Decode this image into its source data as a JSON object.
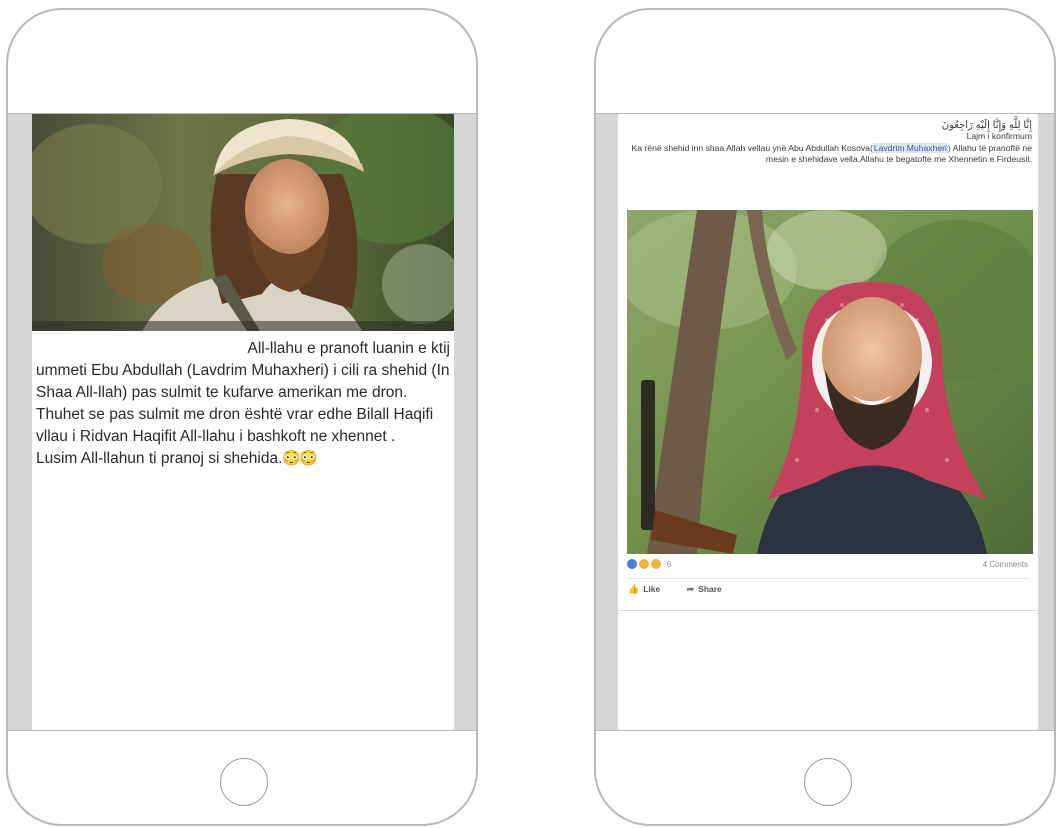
{
  "left_post": {
    "text_lines": [
      "All-llahu e pranoft luanin e ktij",
      "ummeti Ebu Abdullah (Lavdrim Muhaxheri)  i cili ra shehid (In Shaa All-llah) pas sulmit te kufarve amerikan me dron.",
      "Thuhet se pas sulmit me dron është vrar edhe Bilall Haqifi vllau i Ridvan Haqifit All-llahu i bashkoft ne xhennet .",
      "Lusim All-llahun ti pranoj si shehida."
    ],
    "emoji": "😳😳"
  },
  "right_post": {
    "header_arabic": "إِنَّا لِلَّهِ وَإِنَّا إِلَيْهِ رَاجِعُونَ",
    "header_line2": "Lajm i konfirmum",
    "body_before_tag": "Ka rënë shehid inn shaa Allah vellau ynë Abu Abdullah Kosova(",
    "tag": "Lavdrim Muhaxheri",
    "body_after_tag": ") Allahu të pranoftë ne mesin e shehidave vella.Allahu te begatofte me Xhennetin e Firdeusit.",
    "reaction_count": "6",
    "comments": "4 Comments",
    "like_label": "Like",
    "share_label": "Share"
  },
  "colors": {
    "phone_border": "#b8b8b8",
    "screen_gutter": "#d6d6d6",
    "facebook_link": "#3b5998",
    "text": "#2a2a2a"
  }
}
